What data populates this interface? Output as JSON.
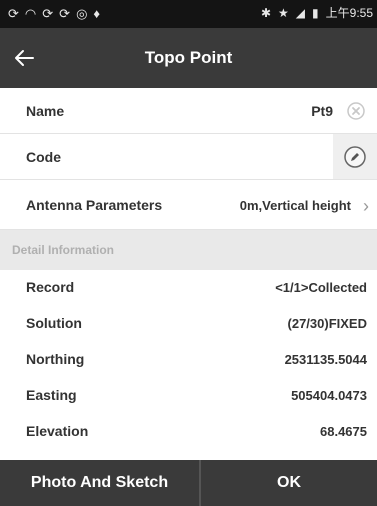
{
  "status": {
    "time": "上午9:55"
  },
  "header": {
    "title": "Topo Point"
  },
  "fields": {
    "name_label": "Name",
    "name_value": "Pt9",
    "code_label": "Code",
    "antenna_label": "Antenna Parameters",
    "antenna_value": "0m,Vertical height"
  },
  "section": {
    "title": "Detail Information"
  },
  "details": [
    {
      "label": "Record",
      "value": "<1/1>Collected"
    },
    {
      "label": "Solution",
      "value": "(27/30)FIXED"
    },
    {
      "label": "Northing",
      "value": "2531135.5044"
    },
    {
      "label": "Easting",
      "value": "505404.0473"
    },
    {
      "label": "Elevation",
      "value": "68.4675"
    }
  ],
  "footer": {
    "photo_label": "Photo And Sketch",
    "ok_label": "OK"
  },
  "icons": {
    "back": "back-arrow-icon",
    "clear": "clear-circle-icon",
    "code": "edit-pen-icon",
    "chevron": "chevron-right-icon"
  }
}
